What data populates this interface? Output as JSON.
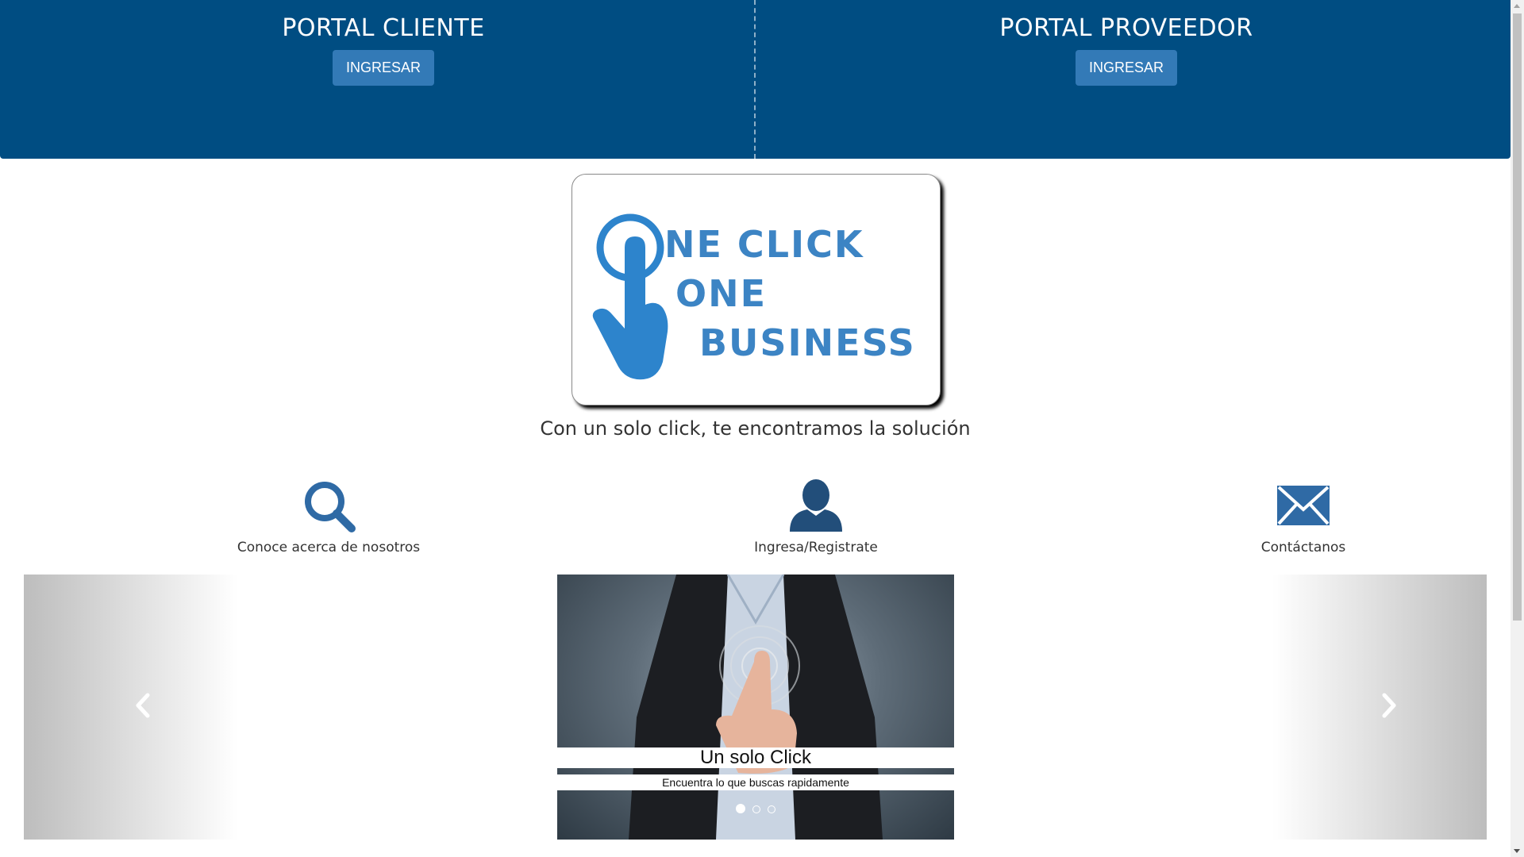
{
  "header": {
    "client_portal": {
      "title": "PORTAL CLIENTE",
      "button_label": "INGRESAR"
    },
    "provider_portal": {
      "title": "PORTAL PROVEEDOR",
      "button_label": "INGRESAR"
    }
  },
  "logo": {
    "line1": "NE CLICK",
    "line2": "ONE",
    "line3": "BUSINESS"
  },
  "tagline": "Con un solo click, te encontramos la solución",
  "features": [
    {
      "label": "Conoce acerca de nosotros",
      "icon": "search-icon"
    },
    {
      "label": "Ingresa/Registrate",
      "icon": "user-icon"
    },
    {
      "label": "Contáctanos",
      "icon": "envelope-icon"
    }
  ],
  "carousel": {
    "caption_title": "Un solo Click",
    "caption_text": "Encuentra lo que buscas rapidamente",
    "slide_count": 3,
    "active_index": 0
  },
  "colors": {
    "banner": "#004d82",
    "button": "#337ab7",
    "icon": "#2f6aa5"
  }
}
